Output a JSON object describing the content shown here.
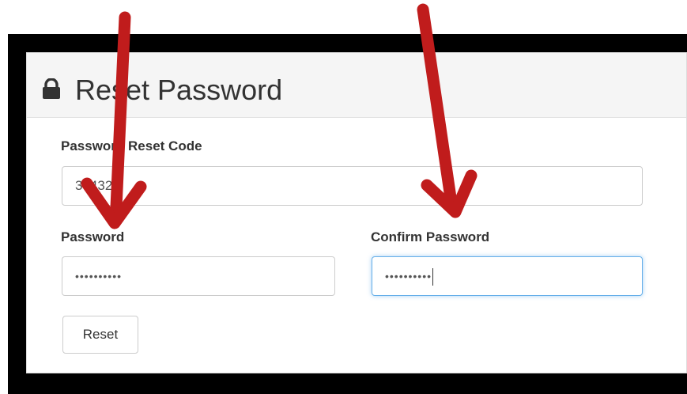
{
  "panel": {
    "title": "Reset Password",
    "heading_icon": "lock-icon"
  },
  "form": {
    "reset_code": {
      "label": "Password Reset Code",
      "value": "30432"
    },
    "password": {
      "label": "Password",
      "value": "••••••••••"
    },
    "confirm_password": {
      "label": "Confirm Password",
      "value": "••••••••••"
    },
    "reset_button_label": "Reset"
  },
  "annotations": {
    "arrow_color": "#c01c1c"
  },
  "colors": {
    "frame": "#000000",
    "heading_bg": "#f5f5f5",
    "focus_border": "#66afe9"
  }
}
